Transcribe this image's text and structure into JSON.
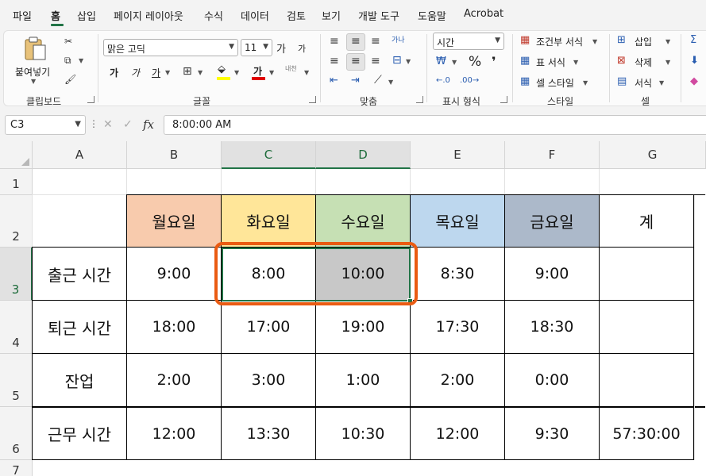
{
  "menu": {
    "items": [
      "파일",
      "홈",
      "삽입",
      "페이지 레이아웃",
      "수식",
      "데이터",
      "검토",
      "보기",
      "개발 도구",
      "도움말",
      "Acrobat"
    ],
    "active": "홈"
  },
  "ribbon": {
    "clipboard": {
      "paste_label": "붙여넣기",
      "group_label": "클립보드"
    },
    "font": {
      "font_name": "맑은 고딕",
      "font_size": "11",
      "grow_label": "가",
      "shrink_label": "가",
      "bold_label": "가",
      "italic_label": "가",
      "underline_label": "가",
      "font_color_label": "가",
      "phonetic_label": "내천",
      "group_label": "글꼴"
    },
    "alignment": {
      "group_label": "맞춤",
      "wrap_label": "가나"
    },
    "number": {
      "format": "시간",
      "percent_label": "%",
      "comma_label": "❜",
      "group_label": "표시 형식"
    },
    "styles": {
      "conditional_label": "조건부 서식",
      "table_label": "표 서식",
      "cell_style_label": "셀 스타일",
      "group_label": "스타일"
    },
    "cells": {
      "insert_label": "삽입",
      "delete_label": "삭제",
      "format_label": "서식",
      "group_label": "셀"
    }
  },
  "formula_bar": {
    "name_box": "C3",
    "cancel_icon": "✕",
    "enter_icon": "✓",
    "fx_label": "fx",
    "value": "8:00:00 AM"
  },
  "sheet": {
    "columns": [
      "A",
      "B",
      "C",
      "D",
      "E",
      "F",
      "G"
    ],
    "rows": [
      "1",
      "2",
      "3",
      "4",
      "5",
      "6",
      "7"
    ],
    "selected_cell": "C3",
    "selection_range": "C3:D3",
    "header_row": [
      "월요일",
      "화요일",
      "수요일",
      "목요일",
      "금요일",
      "계"
    ],
    "header_colors": [
      "#f8cbad",
      "#ffe699",
      "#c6e0b4",
      "#bdd7ee",
      "#acb9ca",
      "#ffffff"
    ],
    "data_rows": [
      {
        "label": "출근 시간",
        "values": [
          "9:00",
          "8:00",
          "10:00",
          "8:30",
          "9:00",
          ""
        ]
      },
      {
        "label": "퇴근 시간",
        "values": [
          "18:00",
          "17:00",
          "19:00",
          "17:30",
          "18:30",
          ""
        ]
      },
      {
        "label": "잔업",
        "values": [
          "2:00",
          "3:00",
          "1:00",
          "2:00",
          "0:00",
          ""
        ]
      },
      {
        "label": "근무 시간",
        "values": [
          "12:00",
          "13:30",
          "10:30",
          "12:00",
          "9:30",
          "57:30:00"
        ]
      }
    ],
    "gray_cell_color": "#c8c8c8",
    "highlight_color": "#ea5b12",
    "accent_color": "#217346"
  }
}
